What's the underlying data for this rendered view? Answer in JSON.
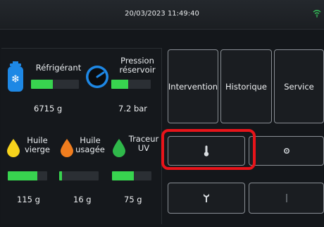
{
  "header": {
    "datetime": "20/03/2023 11:49:40",
    "status_icon": "wifi-icon",
    "status_color": "#35c25a"
  },
  "gauges": {
    "refrigerant": {
      "label": "Réfrigérant",
      "value": "6715 g",
      "icon": "refrigerant-tank-icon",
      "level": 0.45
    },
    "pressure": {
      "label_line1": "Pression",
      "label_line2": "réservoir",
      "value": "7.2 bar",
      "icon": "pressure-gauge-icon",
      "level": 0.42
    },
    "virgin_oil": {
      "label_line1": "Huile",
      "label_line2": "vierge",
      "value": "115 g",
      "icon": "yellow-oil-drop-icon",
      "level": 0.75
    },
    "used_oil": {
      "label_line1": "Huile",
      "label_line2": "usagée",
      "value": "16 g",
      "icon": "orange-oil-drop-icon",
      "level": 0.08
    },
    "uv_tracer": {
      "label_line1": "Traceur",
      "label_line2": "UV",
      "value": "75 g",
      "icon": "green-drop-icon",
      "level": 0.55
    }
  },
  "menu": {
    "intervention": "Intervention",
    "historique": "Historique",
    "service": "Service",
    "thermometer_icon": "thermometer-icon",
    "settings_icon": "gear-icon",
    "wrench_icon": "wrench-icon",
    "info_icon": "info-icon"
  },
  "colors": {
    "level_fill": "#38d44f",
    "highlight": "#e8141a",
    "accent_blue": "#1e88e5"
  }
}
